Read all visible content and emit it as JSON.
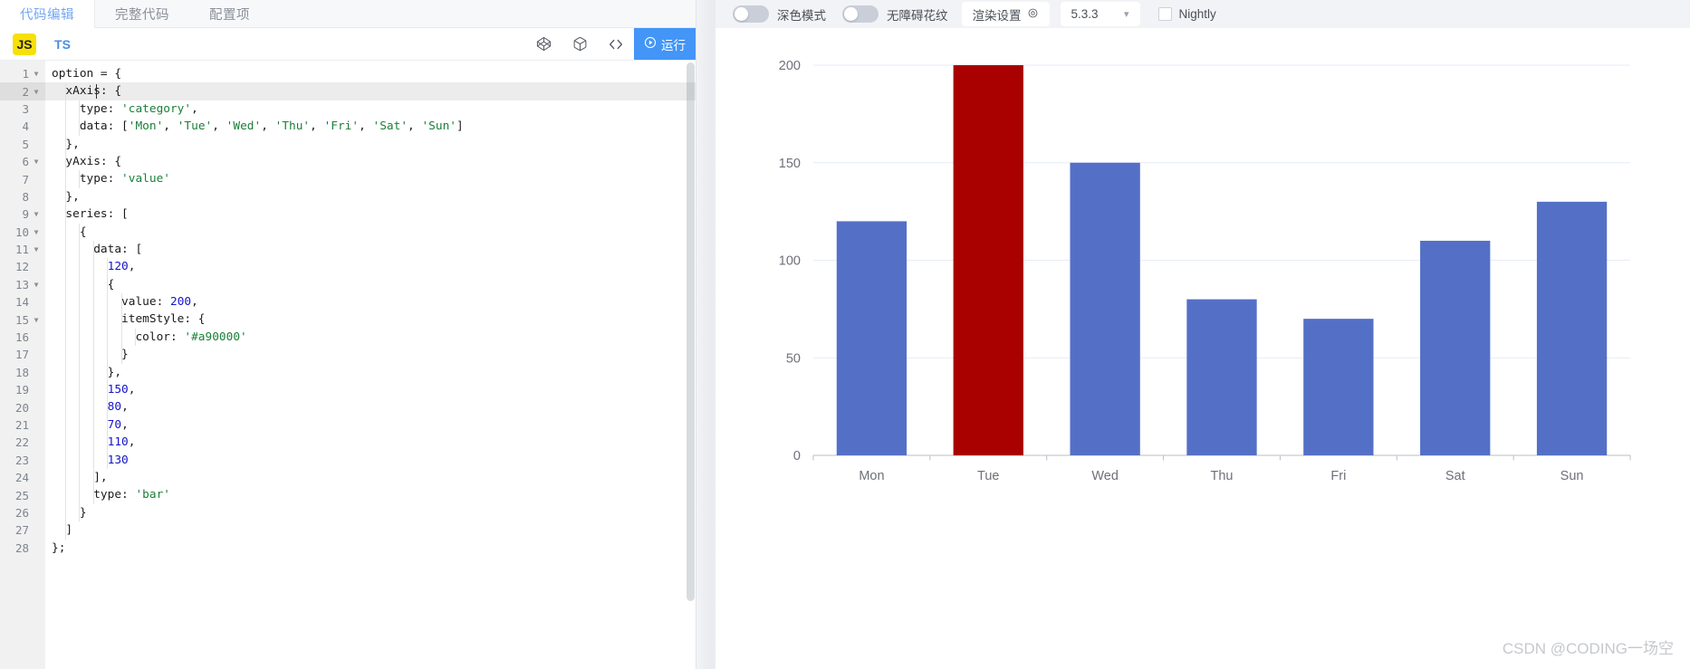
{
  "editor": {
    "tabs": [
      {
        "label": "代码编辑",
        "active": true
      },
      {
        "label": "完整代码",
        "active": false
      },
      {
        "label": "配置项",
        "active": false
      }
    ],
    "lang_js": "JS",
    "lang_ts": "TS",
    "icons": {
      "codepen": "codepen-icon",
      "cube": "cube-icon",
      "code": "code-brackets-icon",
      "run": "play-circle-icon"
    },
    "run_label": "运行",
    "active_line": 2,
    "code_lines": [
      {
        "n": 1,
        "fold": true,
        "indent": 0,
        "text": "option = {"
      },
      {
        "n": 2,
        "fold": true,
        "indent": 1,
        "text": "  xAxis: {"
      },
      {
        "n": 3,
        "fold": false,
        "indent": 2,
        "text": "    type: 'category',"
      },
      {
        "n": 4,
        "fold": false,
        "indent": 2,
        "text": "    data: ['Mon', 'Tue', 'Wed', 'Thu', 'Fri', 'Sat', 'Sun']"
      },
      {
        "n": 5,
        "fold": false,
        "indent": 1,
        "text": "  },"
      },
      {
        "n": 6,
        "fold": true,
        "indent": 1,
        "text": "  yAxis: {"
      },
      {
        "n": 7,
        "fold": false,
        "indent": 2,
        "text": "    type: 'value'"
      },
      {
        "n": 8,
        "fold": false,
        "indent": 1,
        "text": "  },"
      },
      {
        "n": 9,
        "fold": true,
        "indent": 1,
        "text": "  series: ["
      },
      {
        "n": 10,
        "fold": true,
        "indent": 2,
        "text": "    {"
      },
      {
        "n": 11,
        "fold": true,
        "indent": 3,
        "text": "      data: ["
      },
      {
        "n": 12,
        "fold": false,
        "indent": 4,
        "text": "        120,"
      },
      {
        "n": 13,
        "fold": true,
        "indent": 4,
        "text": "        {"
      },
      {
        "n": 14,
        "fold": false,
        "indent": 5,
        "text": "          value: 200,"
      },
      {
        "n": 15,
        "fold": true,
        "indent": 5,
        "text": "          itemStyle: {"
      },
      {
        "n": 16,
        "fold": false,
        "indent": 6,
        "text": "            color: '#a90000'"
      },
      {
        "n": 17,
        "fold": false,
        "indent": 5,
        "text": "          }"
      },
      {
        "n": 18,
        "fold": false,
        "indent": 4,
        "text": "        },"
      },
      {
        "n": 19,
        "fold": false,
        "indent": 4,
        "text": "        150,"
      },
      {
        "n": 20,
        "fold": false,
        "indent": 4,
        "text": "        80,"
      },
      {
        "n": 21,
        "fold": false,
        "indent": 4,
        "text": "        70,"
      },
      {
        "n": 22,
        "fold": false,
        "indent": 4,
        "text": "        110,"
      },
      {
        "n": 23,
        "fold": false,
        "indent": 4,
        "text": "        130"
      },
      {
        "n": 24,
        "fold": false,
        "indent": 3,
        "text": "      ],"
      },
      {
        "n": 25,
        "fold": false,
        "indent": 3,
        "text": "      type: 'bar'"
      },
      {
        "n": 26,
        "fold": false,
        "indent": 2,
        "text": "    }"
      },
      {
        "n": 27,
        "fold": false,
        "indent": 1,
        "text": "  ]"
      },
      {
        "n": 28,
        "fold": false,
        "indent": 0,
        "text": "};"
      }
    ]
  },
  "options_bar": {
    "dark_mode": {
      "label": "深色模式",
      "on": false
    },
    "accessible_pattern": {
      "label": "无障碍花纹",
      "on": false
    },
    "render_settings": {
      "label": "渲染设置",
      "icon": "gear-icon"
    },
    "version": {
      "value": "5.3.3",
      "icon": "chevron-down-icon"
    },
    "nightly": {
      "label": "Nightly",
      "checked": false
    }
  },
  "watermark": "CSDN @CODING一场空",
  "chart_data": {
    "type": "bar",
    "title": "",
    "xlabel": "",
    "ylabel": "",
    "categories": [
      "Mon",
      "Tue",
      "Wed",
      "Thu",
      "Fri",
      "Sat",
      "Sun"
    ],
    "values": [
      120,
      200,
      150,
      80,
      70,
      110,
      130
    ],
    "series": [
      {
        "name": "bar",
        "values": [
          120,
          200,
          150,
          80,
          70,
          110,
          130
        ]
      }
    ],
    "bar_colors": [
      "#5470c6",
      "#a90000",
      "#5470c6",
      "#5470c6",
      "#5470c6",
      "#5470c6",
      "#5470c6"
    ],
    "default_color": "#5470c6",
    "highlight_color": "#a90000",
    "ylim": [
      0,
      200
    ],
    "yticks": [
      0,
      50,
      100,
      150,
      200
    ],
    "ytick_labels": [
      "0",
      "50",
      "100",
      "150",
      "200"
    ],
    "grid": true,
    "grid_color": "#e6ebf8",
    "axis_line_color": "#b9bfc9",
    "legend": null
  }
}
